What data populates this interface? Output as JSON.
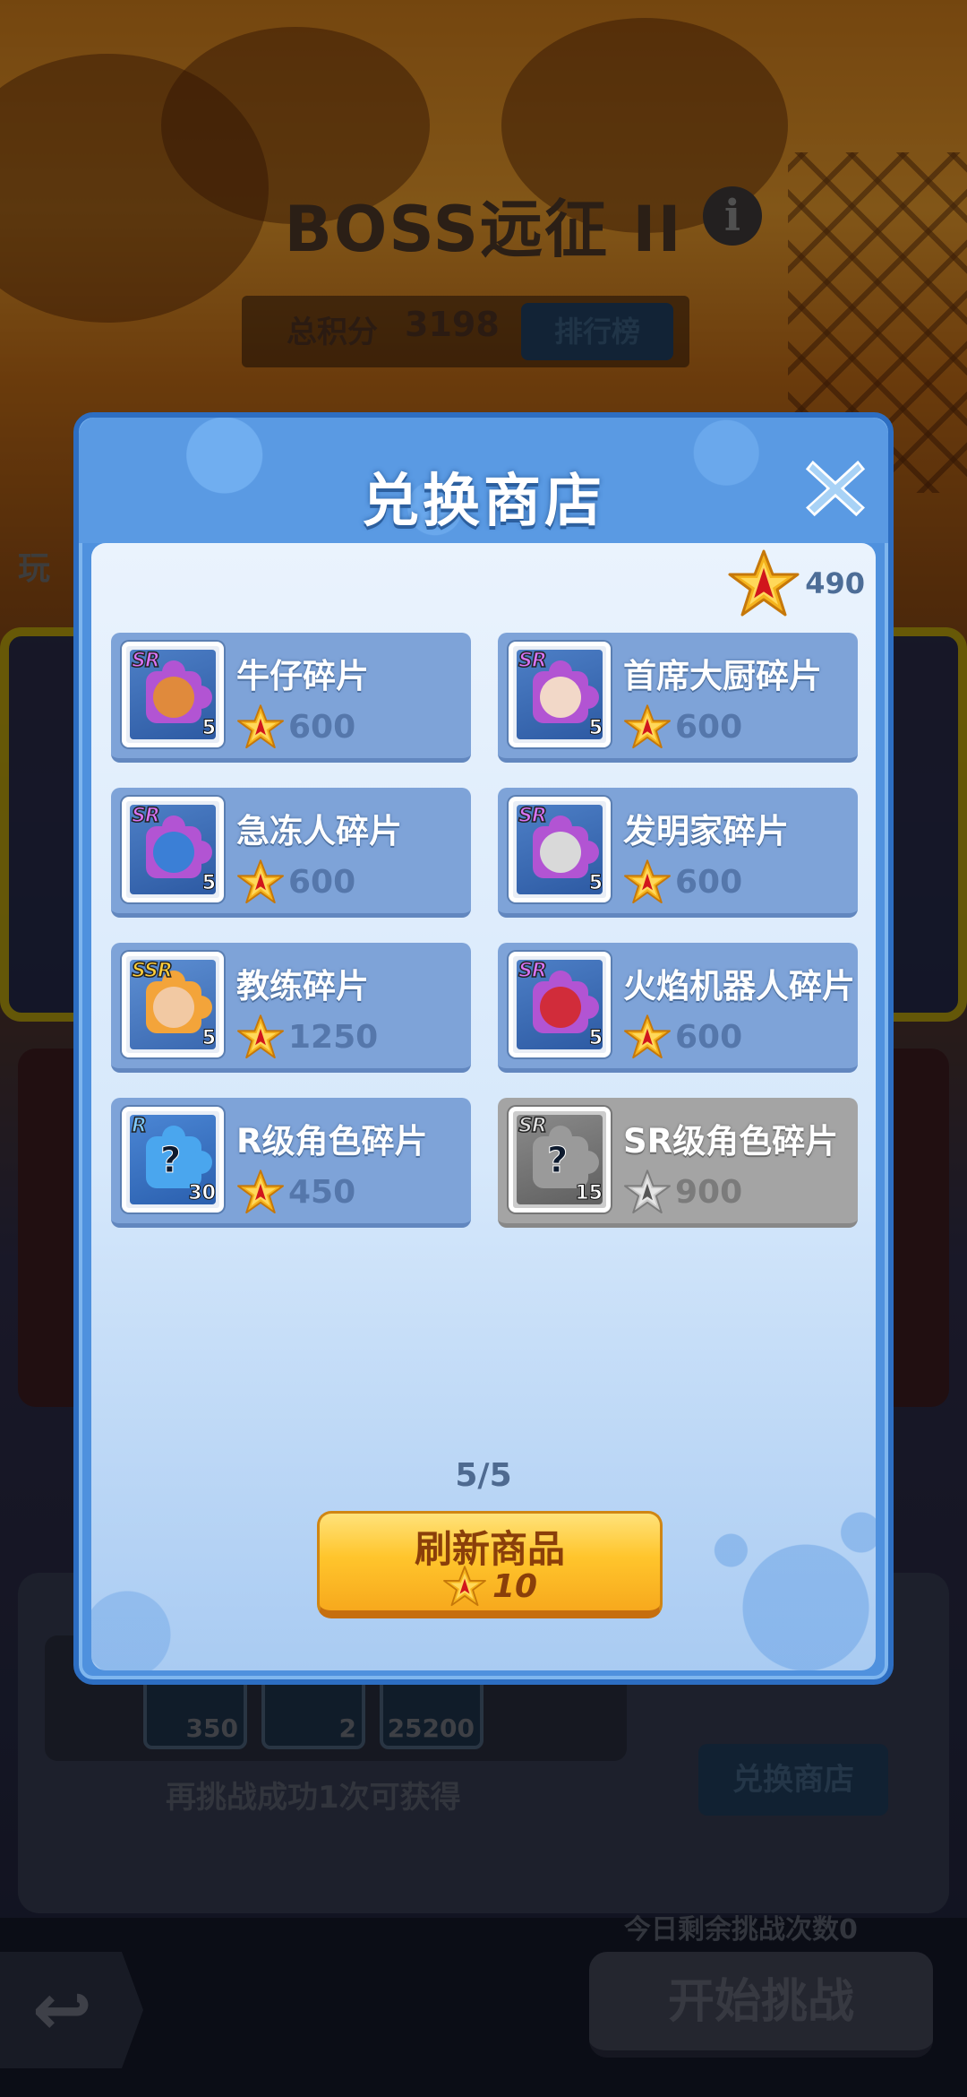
{
  "background": {
    "title": "BOSS远征 II",
    "info_icon": "i",
    "score_label": "总积分",
    "score_value": "3198",
    "rank_button": "排行榜",
    "left_tab": "玩",
    "reward_slots": [
      "350",
      "2",
      "25200"
    ],
    "reward_hint": "再挑战成功1次可获得",
    "shop_button": "兑换商店",
    "remaining_text": "今日剩余挑战次数0",
    "start_button": "开始挑战"
  },
  "dialog": {
    "title": "兑换商店",
    "balance": "490",
    "close_icon": "close-x-icon",
    "items": [
      {
        "name": "牛仔碎片",
        "price": "600",
        "rarity": "SR",
        "qty": "5",
        "color": "purple",
        "face": "#e08a3c"
      },
      {
        "name": "首席大厨碎片",
        "price": "600",
        "rarity": "SR",
        "qty": "5",
        "color": "purple",
        "face": "#f2d8c8"
      },
      {
        "name": "急冻人碎片",
        "price": "600",
        "rarity": "SR",
        "qty": "5",
        "color": "purple",
        "face": "#3b7fd6"
      },
      {
        "name": "发明家碎片",
        "price": "600",
        "rarity": "SR",
        "qty": "5",
        "color": "purple",
        "face": "#d9d9d9"
      },
      {
        "name": "教练碎片",
        "price": "1250",
        "rarity": "SSR",
        "qty": "5",
        "color": "orange",
        "face": "#f2c9a3"
      },
      {
        "name": "火焰机器人碎片",
        "price": "600",
        "rarity": "SR",
        "qty": "5",
        "color": "purple",
        "face": "#d12c3a"
      },
      {
        "name": "R级角色碎片",
        "price": "450",
        "rarity": "R",
        "qty": "30",
        "color": "blue",
        "face": ""
      },
      {
        "name": "SR级角色碎片",
        "price": "900",
        "rarity": "SR",
        "qty": "15",
        "color": "gray",
        "face": ""
      }
    ],
    "refresh_count": "5/5",
    "refresh_label": "刷新商品",
    "refresh_cost": "10"
  },
  "colors": {
    "dialog_blue": "#4f91de",
    "card_blue": "#7ea3d8",
    "card_gray": "#a4a4a4",
    "star_gold": "#f5b41d",
    "button_yellow": "#ffc52c"
  }
}
